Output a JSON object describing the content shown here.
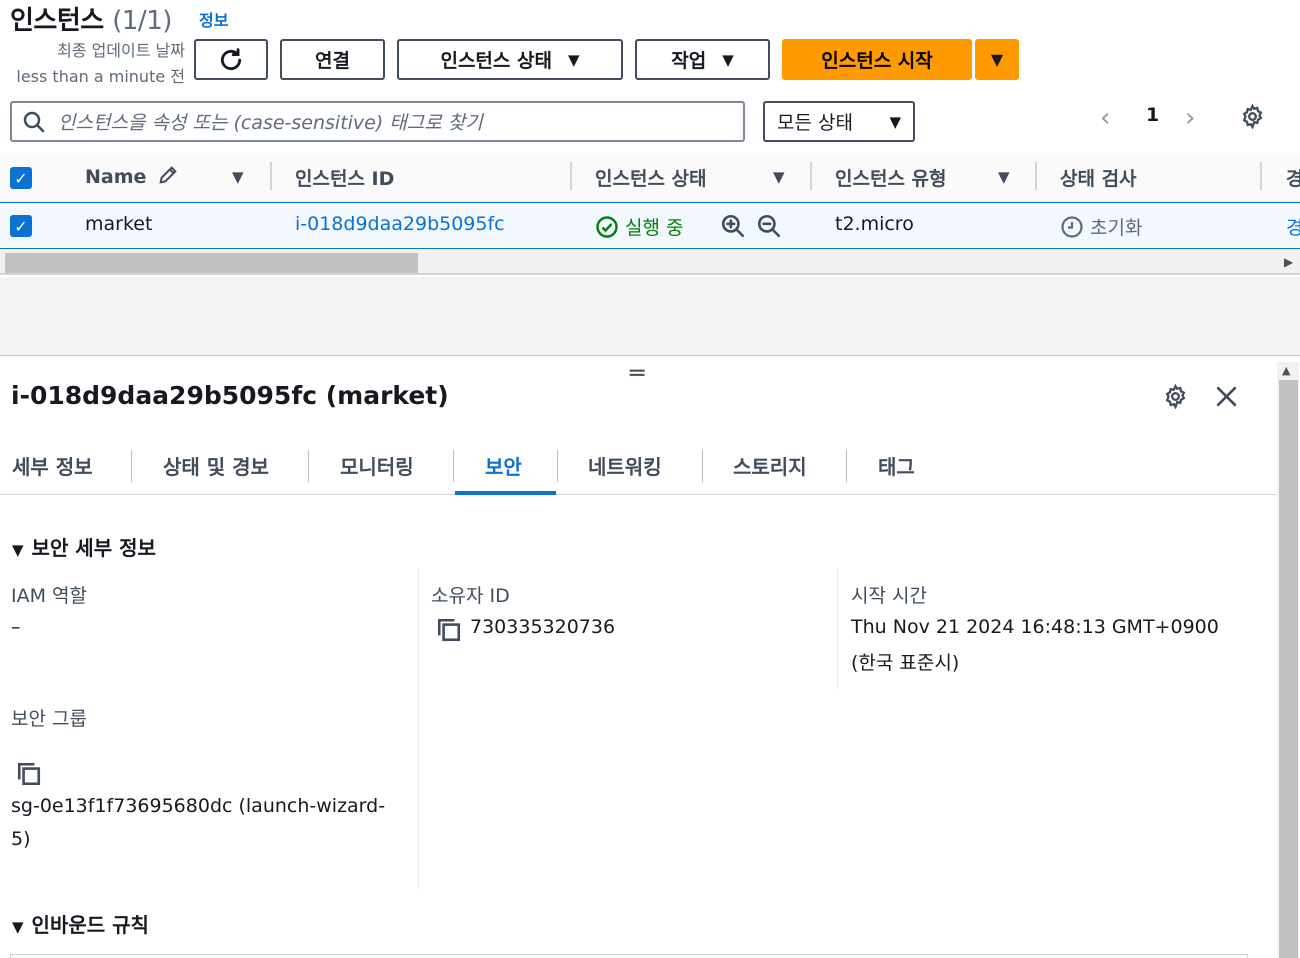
{
  "header": {
    "title": "인스턴스",
    "count": "(1/1)",
    "info_link": "정보",
    "updated_line1": "최종 업데이트 날짜",
    "updated_line2": "less than a minute 전",
    "connect_label": "연결",
    "instance_state_label": "인스턴스 상태",
    "actions_label": "작업",
    "launch_label": "인스턴스 시작"
  },
  "search": {
    "placeholder": "인스턴스을 속성 또는 (case-sensitive) 태그로 찾기",
    "filter_value": "모든 상태"
  },
  "pager": {
    "current_page": "1"
  },
  "table": {
    "columns": [
      "Name",
      "인스턴스 ID",
      "인스턴스 상태",
      "인스턴스 유형",
      "상태 검사",
      "경"
    ],
    "row": {
      "name": "market",
      "instance_id": "i-018d9daa29b5095fc",
      "state": "실행 중",
      "type": "t2.micro",
      "status_check": "초기화",
      "alarm_partial": "경"
    }
  },
  "details": {
    "title": "i-018d9daa29b5095fc (market)",
    "tabs": [
      "세부 정보",
      "상태 및 경보",
      "모니터링",
      "보안",
      "네트워킹",
      "스토리지",
      "태그"
    ],
    "active_tab": "보안",
    "security_section": "보안 세부 정보",
    "iam_label": "IAM 역할",
    "iam_value": "–",
    "owner_label": "소유자 ID",
    "owner_value": "730335320736",
    "launch_time_label": "시작 시간",
    "launch_time_line1": "Thu Nov 21 2024 16:48:13 GMT+0900",
    "launch_time_line2": "(한국 표준시)",
    "sg_label": "보안 그룹",
    "sg_line1": "sg-0e13f1f73695680dc (launch-wizard-",
    "sg_line2": "5)",
    "inbound_section": "인바운드 규칙"
  },
  "colors": {
    "primary": "#ff9900",
    "link": "#0972d3",
    "running": "#037f0c"
  }
}
